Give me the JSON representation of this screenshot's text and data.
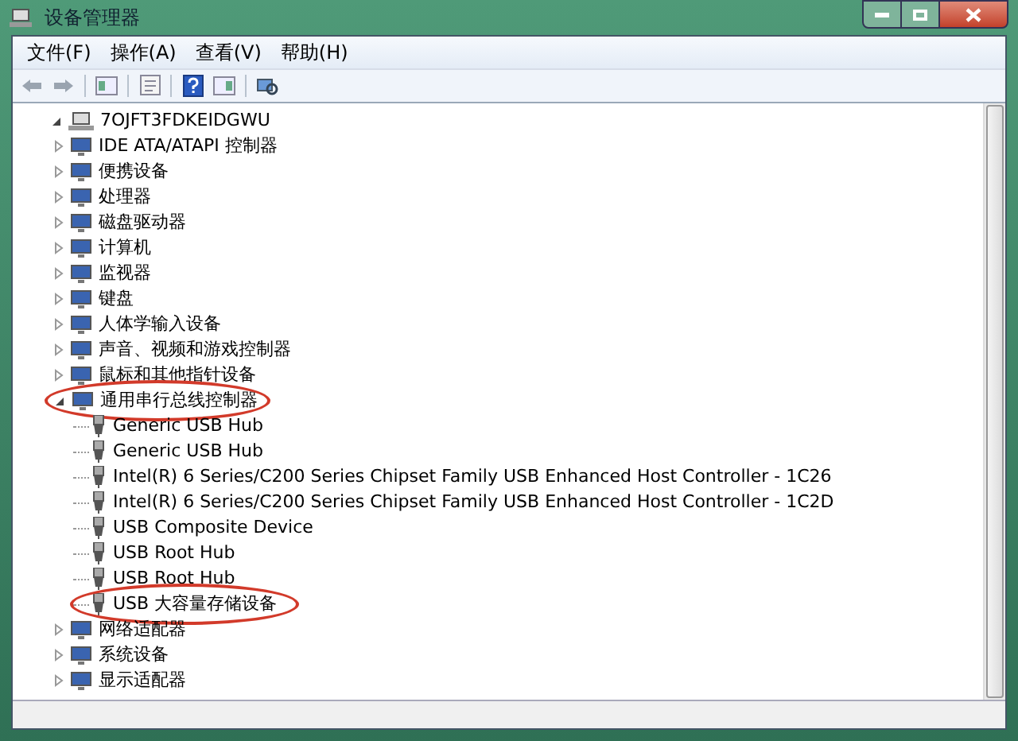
{
  "window": {
    "title": "设备管理器"
  },
  "menu": [
    "文件(F)",
    "操作(A)",
    "查看(V)",
    "帮助(H)"
  ],
  "tree": {
    "label": "7OJFT3FDKEIDGWU",
    "expanded": true,
    "children": [
      {
        "label": "IDE ATA/ATAPI 控制器",
        "expanded": false,
        "circled": false
      },
      {
        "label": "便携设备",
        "expanded": false,
        "circled": false
      },
      {
        "label": "处理器",
        "expanded": false,
        "circled": false
      },
      {
        "label": "磁盘驱动器",
        "expanded": false,
        "circled": false
      },
      {
        "label": "计算机",
        "expanded": false,
        "circled": false
      },
      {
        "label": "监视器",
        "expanded": false,
        "circled": false
      },
      {
        "label": "键盘",
        "expanded": false,
        "circled": false
      },
      {
        "label": "人体学输入设备",
        "expanded": false,
        "circled": false
      },
      {
        "label": "声音、视频和游戏控制器",
        "expanded": false,
        "circled": false
      },
      {
        "label": "鼠标和其他指针设备",
        "expanded": false,
        "circled": false
      },
      {
        "label": "通用串行总线控制器",
        "expanded": true,
        "circled": true,
        "children": [
          {
            "label": "Generic USB Hub",
            "circled": false
          },
          {
            "label": "Generic USB Hub",
            "circled": false
          },
          {
            "label": "Intel(R) 6 Series/C200 Series Chipset Family USB Enhanced Host Controller - 1C26",
            "circled": false
          },
          {
            "label": "Intel(R) 6 Series/C200 Series Chipset Family USB Enhanced Host Controller - 1C2D",
            "circled": false
          },
          {
            "label": "USB Composite Device",
            "circled": false
          },
          {
            "label": "USB Root Hub",
            "circled": false
          },
          {
            "label": "USB Root Hub",
            "circled": false
          },
          {
            "label": "USB 大容量存储设备",
            "circled": true
          }
        ]
      },
      {
        "label": "网络适配器",
        "expanded": false,
        "circled": false
      },
      {
        "label": "系统设备",
        "expanded": false,
        "circled": false
      },
      {
        "label": "显示适配器",
        "expanded": false,
        "circled": false
      }
    ]
  }
}
